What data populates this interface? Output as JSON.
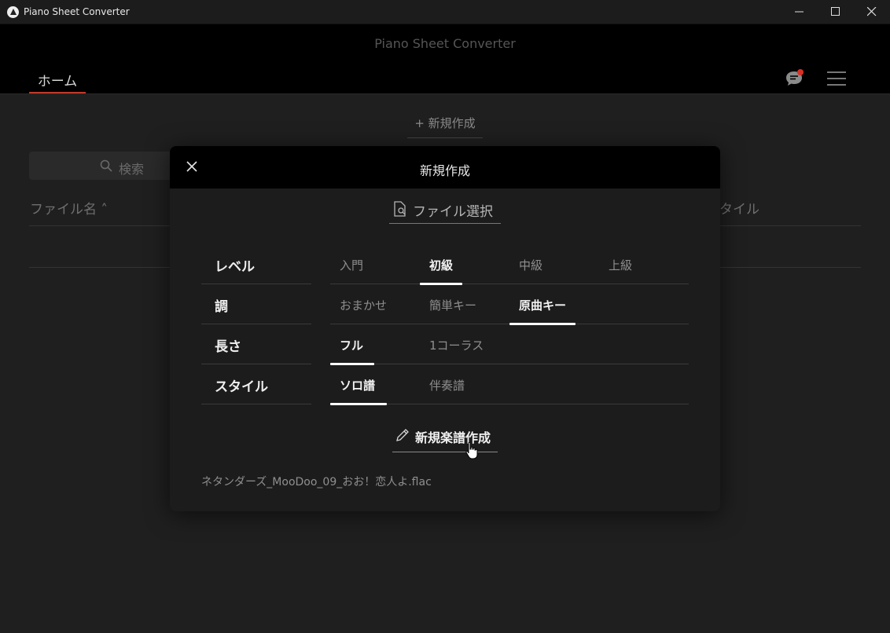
{
  "window": {
    "title": "Piano Sheet Converter"
  },
  "header": {
    "app_title": "Piano Sheet Converter",
    "tabs": [
      {
        "label": "ホーム",
        "active": true
      }
    ],
    "icons": [
      "chat-notification-icon",
      "hamburger-menu-icon"
    ],
    "accent_color": "#c0392b",
    "notification_color": "#d93025"
  },
  "page": {
    "new_button_label": "+ 新規作成",
    "search_placeholder": "検索",
    "columns": {
      "filename": "ファイル名 ˄",
      "style": "タイル"
    }
  },
  "modal": {
    "title": "新規作成",
    "file_select_label": "ファイル選択",
    "rows": [
      {
        "label": "レベル",
        "options": [
          "入門",
          "初級",
          "中級",
          "上級"
        ],
        "selected": "初級"
      },
      {
        "label": "調",
        "options": [
          "おまかせ",
          "簡単キー",
          "原曲キー"
        ],
        "selected": "原曲キー"
      },
      {
        "label": "長さ",
        "options": [
          "フル",
          "1コーラス"
        ],
        "selected": "フル"
      },
      {
        "label": "スタイル",
        "options": [
          "ソロ譜",
          "伴奏譜"
        ],
        "selected": "ソロ譜"
      }
    ],
    "create_button_label": "新規楽譜作成",
    "selected_file": "ネタンダーズ_MooDoo_09_おお！恋人よ.flac"
  }
}
